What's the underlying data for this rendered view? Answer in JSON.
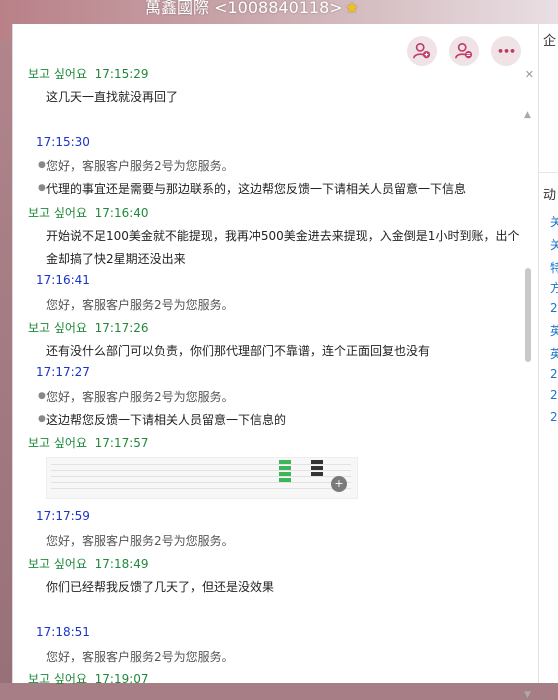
{
  "header": {
    "title": "萬鑫國際 <1008840118>"
  },
  "toolbar": {
    "more_label": "•••"
  },
  "side": {
    "tab_top": "企",
    "tab_mid": "动",
    "items": [
      "关",
      "关",
      "特",
      "方",
      "2",
      "英",
      "英",
      "2",
      "2",
      "2"
    ]
  },
  "messages": [
    {
      "type": "user",
      "sender": "보고 싶어요",
      "time": "17:15:29",
      "lines": [
        "这几天一直找就没再回了"
      ]
    },
    {
      "type": "agent",
      "time": "17:15:30",
      "lines": [
        "您好，客服客户服务2号为您服务。",
        "代理的事宜还是需要与那边联系的，这边帮您反馈一下请相关人员留意一下信息"
      ]
    },
    {
      "type": "user",
      "sender": "보고 싶어요",
      "time": "17:16:40",
      "lines": [
        "开始说不足100美金就不能提现，我再冲500美金进去来提现，入金倒是1小时到账，出个",
        "金却搞了快2星期还没出来"
      ]
    },
    {
      "type": "agent",
      "time": "17:16:41",
      "lines": [
        "您好，客服客户服务2号为您服务。"
      ]
    },
    {
      "type": "user",
      "sender": "보고 싶어요",
      "time": "17:17:26",
      "lines": [
        "还有没什么部门可以负责，你们那代理部门不靠谱，连个正面回复也没有"
      ]
    },
    {
      "type": "agent",
      "time": "17:17:27",
      "lines": [
        "您好，客服客户服务2号为您服务。",
        "这边帮您反馈一下请相关人员留意一下信息的"
      ]
    },
    {
      "type": "user",
      "sender": "보고 싶어요",
      "time": "17:17:57",
      "lines": []
    },
    {
      "type": "agent",
      "time": "17:17:59",
      "lines": [
        "您好，客服客户服务2号为您服务。"
      ]
    },
    {
      "type": "user",
      "sender": "보고 싶어요",
      "time": "17:18:49",
      "lines": [
        "你们已经帮我反馈了几天了，但还是没效果"
      ]
    },
    {
      "type": "agent",
      "time": "17:18:51",
      "lines": [
        "您好，客服客户服务2号为您服务。"
      ]
    },
    {
      "type": "user",
      "sender": "보고 싶어요",
      "time": "17:19:07",
      "lines": []
    }
  ]
}
